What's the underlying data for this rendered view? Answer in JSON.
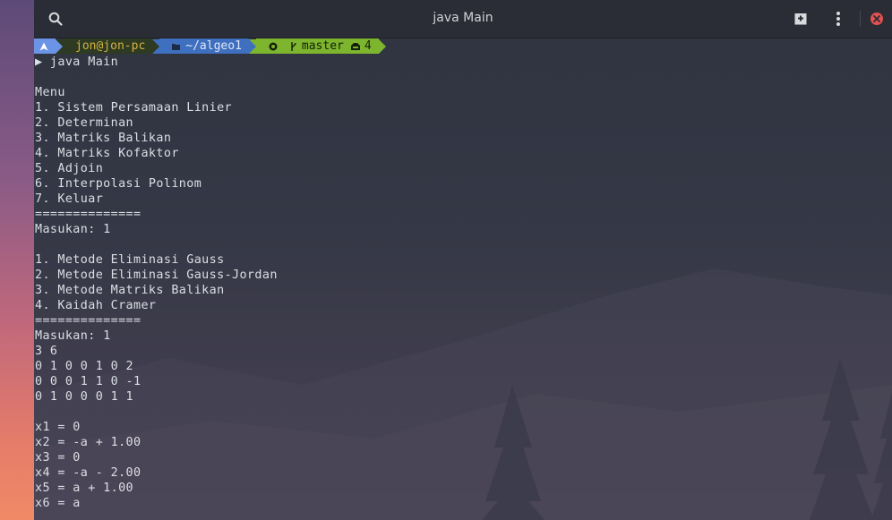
{
  "window": {
    "title": "java Main"
  },
  "icons": {
    "search": "search-icon",
    "new_tab": "new-tab-icon",
    "menu": "kebab-menu-icon",
    "close": "close-icon",
    "os": "arch-linux-icon",
    "folder": "folder-icon",
    "git": "github-icon",
    "branch": "git-branch-icon",
    "stash": "stash-icon"
  },
  "colors": {
    "close_button": "#e0524f",
    "os_segment": "#6b93e6",
    "user_segment": "#2f3a22",
    "dir_segment": "#3f6fbf",
    "git_segment": "#7db52e"
  },
  "prompt": {
    "user": "jon@jon-pc",
    "directory": "~/algeo1",
    "branch": "master",
    "stash_count": "4"
  },
  "output": [
    "▶ java Main",
    "",
    "Menu",
    "1. Sistem Persamaan Linier",
    "2. Determinan",
    "3. Matriks Balikan",
    "4. Matriks Kofaktor",
    "5. Adjoin",
    "6. Interpolasi Polinom",
    "7. Keluar",
    "==============",
    "Masukan: 1",
    "",
    "1. Metode Eliminasi Gauss",
    "2. Metode Eliminasi Gauss-Jordan",
    "3. Metode Matriks Balikan",
    "4. Kaidah Cramer",
    "==============",
    "Masukan: 1",
    "3 6",
    "0 1 0 0 1 0 2",
    "0 0 0 1 1 0 -1",
    "0 1 0 0 0 1 1",
    "",
    "x1 = 0",
    "x2 = -a + 1.00",
    "x3 = 0",
    "x4 = -a - 2.00",
    "x5 = a + 1.00",
    "x6 = a"
  ]
}
